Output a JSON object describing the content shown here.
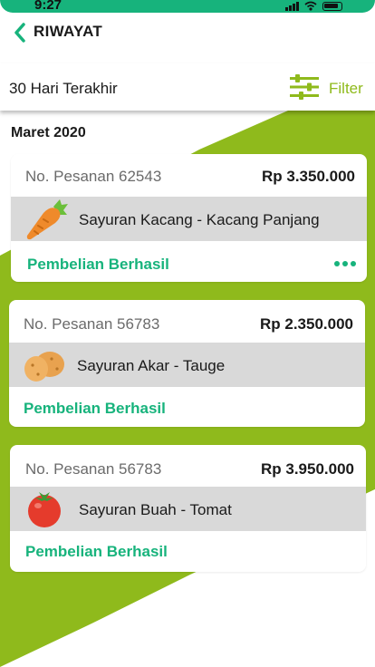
{
  "status_bar": {
    "time": "9:27",
    "bar_color": "#17b37c"
  },
  "header": {
    "title": "RIWAYAT",
    "back_icon": "chevron-left-icon"
  },
  "filter_bar": {
    "period": "30 Hari Terakhir",
    "filter_label": "Filter",
    "filter_icon": "sliders-icon"
  },
  "month": "Maret 2020",
  "orders": [
    {
      "number": "No. Pesanan 62543",
      "price": "Rp 3.350.000",
      "item": "Sayuran Kacang - Kacang Panjang",
      "item_icon": "carrot-icon",
      "status": "Pembelian Berhasil"
    },
    {
      "number": "No. Pesanan 56783",
      "price": "Rp 2.350.000",
      "item": "Sayuran Akar - Tauge",
      "item_icon": "potato-icon",
      "status": "Pembelian Berhasil"
    },
    {
      "number": "No. Pesanan 56783",
      "price": "Rp 3.950.000",
      "item": "Sayuran Buah - Tomat",
      "item_icon": "tomato-icon",
      "status": "Pembelian Berhasil"
    }
  ],
  "colors": {
    "accent_green": "#17b37c",
    "olive": "#8fba1c",
    "row_gray": "#d9d9d9"
  }
}
